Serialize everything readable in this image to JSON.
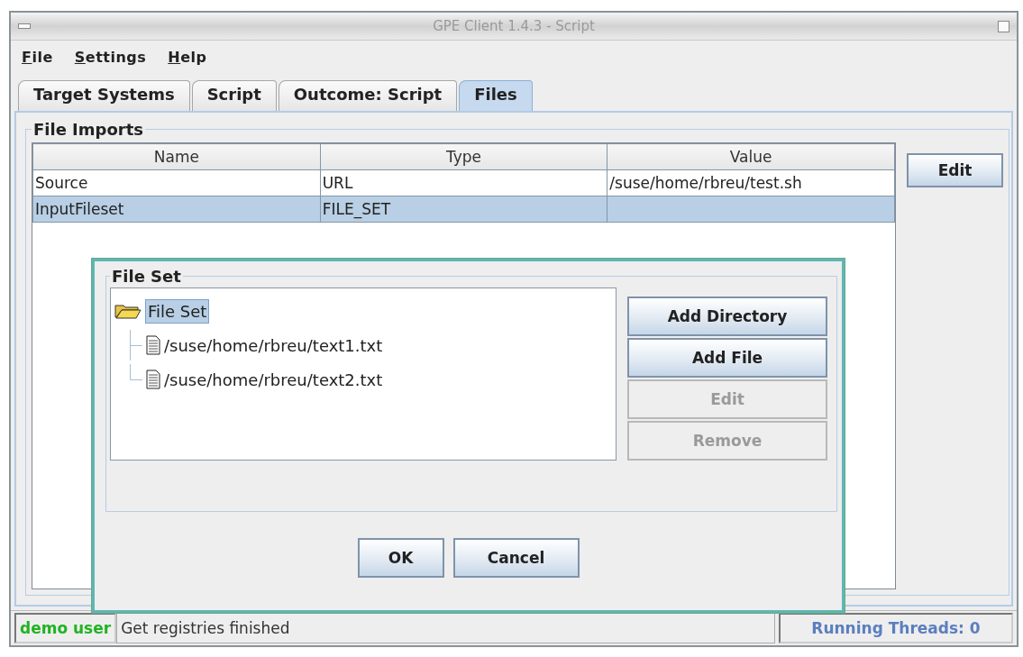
{
  "window": {
    "title": "GPE Client 1.4.3 - Script"
  },
  "menu": [
    {
      "label": "File"
    },
    {
      "label": "Settings"
    },
    {
      "label": "Help"
    }
  ],
  "tabs": [
    {
      "label": "Target Systems",
      "selected": false
    },
    {
      "label": "Script",
      "selected": false
    },
    {
      "label": "Outcome: Script",
      "selected": false
    },
    {
      "label": "Files",
      "selected": true
    }
  ],
  "file_imports": {
    "title": "File Imports",
    "columns": [
      "Name",
      "Type",
      "Value"
    ],
    "rows": [
      {
        "cells": [
          "Source",
          "URL",
          "/suse/home/rbreu/test.sh"
        ],
        "selected": false
      },
      {
        "cells": [
          "InputFileset",
          "FILE_SET",
          ""
        ],
        "selected": true
      }
    ],
    "edit_button": "Edit"
  },
  "dialog": {
    "group_title": "File Set",
    "tree": {
      "label": "File Set",
      "selected": true,
      "children": [
        {
          "label": "/suse/home/rbreu/text1.txt"
        },
        {
          "label": "/suse/home/rbreu/text2.txt"
        }
      ]
    },
    "side_buttons": [
      {
        "label": "Add Directory",
        "disabled": false
      },
      {
        "label": "Add File",
        "disabled": false
      },
      {
        "label": "Edit",
        "disabled": true
      },
      {
        "label": "Remove",
        "disabled": true
      }
    ],
    "footer_buttons": [
      "OK",
      "Cancel"
    ]
  },
  "status_bar": {
    "user": "demo user",
    "message": "Get registries finished",
    "threads": "Running Threads: 0"
  }
}
